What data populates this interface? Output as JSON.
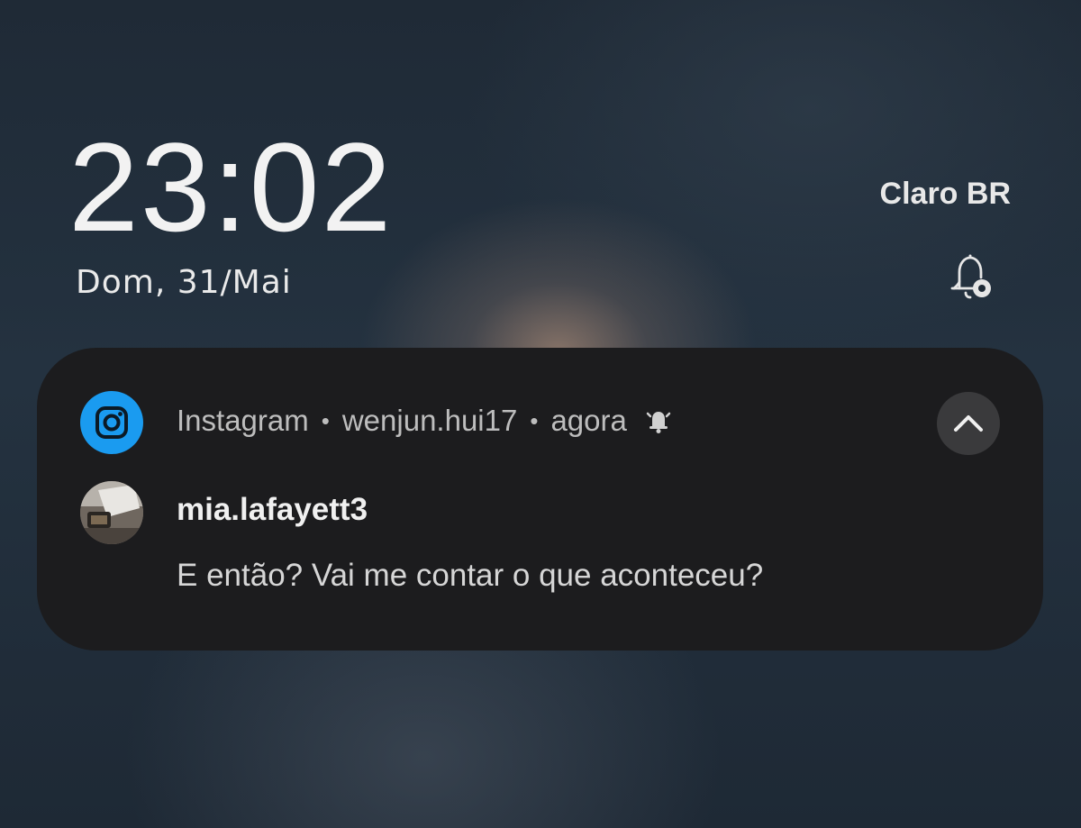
{
  "lockscreen": {
    "time": "23:02",
    "date": "Dom, 31/Mai",
    "carrier": "Claro BR"
  },
  "notification": {
    "app_name": "Instagram",
    "account": "wenjun.hui17",
    "time_ago": "agora",
    "sender": "mia.lafayett3",
    "message": "E então? Vai me contar o que aconteceu?",
    "separator": "•"
  },
  "icons": {
    "app_icon": "instagram-icon",
    "status_icon": "bell-settings-icon",
    "header_bell": "bell-ring-icon",
    "collapse": "chevron-up-icon",
    "avatar": "avatar-image"
  },
  "colors": {
    "instagram_blue": "#1a9bf0",
    "card_background": "#1c1c1e"
  }
}
